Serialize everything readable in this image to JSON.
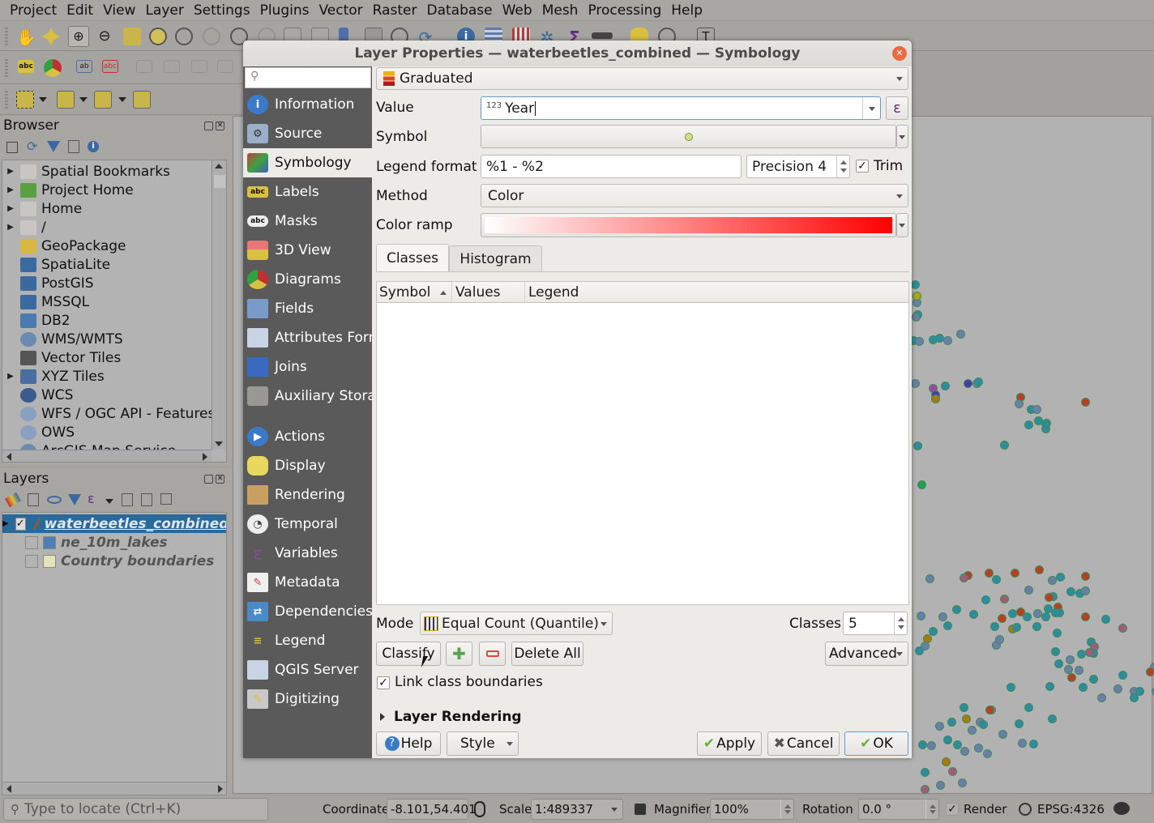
{
  "menubar": [
    "Project",
    "Edit",
    "View",
    "Layer",
    "Settings",
    "Plugins",
    "Vector",
    "Raster",
    "Database",
    "Web",
    "Mesh",
    "Processing",
    "Help"
  ],
  "browser_panel": {
    "title": "Browser",
    "items": [
      {
        "label": "Spatial Bookmarks",
        "icon": "bookmark-icon",
        "expandable": true
      },
      {
        "label": "Project Home",
        "icon": "project-home-icon",
        "expandable": true
      },
      {
        "label": "Home",
        "icon": "home-folder-icon",
        "expandable": true
      },
      {
        "label": "/",
        "icon": "folder-icon",
        "expandable": true
      },
      {
        "label": "GeoPackage",
        "icon": "geopackage-icon",
        "expandable": false
      },
      {
        "label": "SpatiaLite",
        "icon": "spatialite-icon",
        "expandable": false
      },
      {
        "label": "PostGIS",
        "icon": "postgis-icon",
        "expandable": false
      },
      {
        "label": "MSSQL",
        "icon": "mssql-icon",
        "expandable": false
      },
      {
        "label": "DB2",
        "icon": "db2-icon",
        "expandable": false
      },
      {
        "label": "WMS/WMTS",
        "icon": "wms-globe-icon",
        "expandable": false
      },
      {
        "label": "Vector Tiles",
        "icon": "vector-tiles-icon",
        "expandable": false
      },
      {
        "label": "XYZ Tiles",
        "icon": "xyz-tiles-icon",
        "expandable": true
      },
      {
        "label": "WCS",
        "icon": "wcs-globe-icon",
        "expandable": false
      },
      {
        "label": "WFS / OGC API - Features",
        "icon": "wfs-globe-icon",
        "expandable": false
      },
      {
        "label": "OWS",
        "icon": "ows-globe-icon",
        "expandable": false
      },
      {
        "label": "ArcGIS Map Service",
        "icon": "arcgis-globe-icon",
        "expandable": false
      }
    ]
  },
  "layers_panel": {
    "title": "Layers",
    "layers": [
      {
        "name": "waterbeetles_combined",
        "checked": true,
        "selected": true
      },
      {
        "name": "ne_10m_lakes",
        "checked": false,
        "selected": false,
        "swatch": "#4e7fb5"
      },
      {
        "name": "Country boundaries",
        "checked": false,
        "selected": false,
        "swatch": "#e4e2b8"
      }
    ]
  },
  "dialog": {
    "title": "Layer Properties — waterbeetles_combined — Symbology",
    "search_placeholder": "",
    "sidebar": [
      {
        "label": "Information",
        "icon": "information-icon"
      },
      {
        "label": "Source",
        "icon": "source-icon"
      },
      {
        "label": "Symbology",
        "icon": "symbology-icon",
        "active": true
      },
      {
        "label": "Labels",
        "icon": "labels-icon"
      },
      {
        "label": "Masks",
        "icon": "masks-icon"
      },
      {
        "label": "3D View",
        "icon": "3d-view-icon"
      },
      {
        "label": "Diagrams",
        "icon": "diagrams-icon"
      },
      {
        "label": "Fields",
        "icon": "fields-icon"
      },
      {
        "label": "Attributes Form",
        "icon": "attributes-form-icon"
      },
      {
        "label": "Joins",
        "icon": "joins-icon"
      },
      {
        "label": "Auxiliary Storage",
        "icon": "auxiliary-storage-icon"
      },
      {
        "label": "Actions",
        "icon": "actions-icon"
      },
      {
        "label": "Display",
        "icon": "display-icon"
      },
      {
        "label": "Rendering",
        "icon": "rendering-icon"
      },
      {
        "label": "Temporal",
        "icon": "temporal-icon"
      },
      {
        "label": "Variables",
        "icon": "variables-icon"
      },
      {
        "label": "Metadata",
        "icon": "metadata-icon"
      },
      {
        "label": "Dependencies",
        "icon": "dependencies-icon"
      },
      {
        "label": "Legend",
        "icon": "legend-icon"
      },
      {
        "label": "QGIS Server",
        "icon": "qgis-server-icon"
      },
      {
        "label": "Digitizing",
        "icon": "digitizing-icon"
      }
    ],
    "renderer": "Graduated",
    "value_label": "Value",
    "value_type_badge": "123",
    "value": "Year",
    "expression_button": "ε",
    "symbol_label": "Symbol",
    "symbol_color": "#d7dc8a",
    "legend_format_label": "Legend format",
    "legend_format": "%1 - %2",
    "precision": "Precision 4",
    "trim_label": "Trim",
    "trim_checked": true,
    "method_label": "Method",
    "method": "Color",
    "color_ramp_label": "Color ramp",
    "color_ramp": {
      "start": "#ffffff",
      "end": "#ff0000"
    },
    "tabs": [
      {
        "label": "Classes",
        "active": true
      },
      {
        "label": "Histogram",
        "active": false
      }
    ],
    "table_headers": [
      "Symbol",
      "Values",
      "Legend"
    ],
    "table_rows": [],
    "mode_label": "Mode",
    "mode": "Equal Count (Quantile)",
    "classes_label": "Classes",
    "classes": "5",
    "classify_label": "Classify",
    "delete_all_label": "Delete All",
    "advanced_label": "Advanced",
    "link_boundaries_label": "Link class boundaries",
    "link_boundaries_checked": true,
    "layer_rendering_label": "Layer Rendering",
    "help_label": "Help",
    "style_label": "Style",
    "apply_label": "Apply",
    "cancel_label": "Cancel",
    "ok_label": "OK"
  },
  "statusbar": {
    "locate_placeholder": "Type to locate (Ctrl+K)",
    "coordinate_label": "Coordinate",
    "coordinate": "-8.101,54.401",
    "scale_label": "Scale",
    "scale": "1:489337",
    "magnifier_label": "Magnifier",
    "magnifier": "100%",
    "rotation_label": "Rotation",
    "rotation": "0.0 °",
    "render_label": "Render",
    "render_checked": true,
    "crs": "EPSG:4326"
  },
  "map_points_palette": {
    "teal": "#2e8c9c",
    "slate": "#6a7fa8",
    "red": "#b84020",
    "rose": "#a05c78",
    "amber": "#a87a10",
    "violet": "#4a3aa8",
    "magenta": "#9c4aa0",
    "olive": "#a8a814",
    "green": "#20a050"
  }
}
